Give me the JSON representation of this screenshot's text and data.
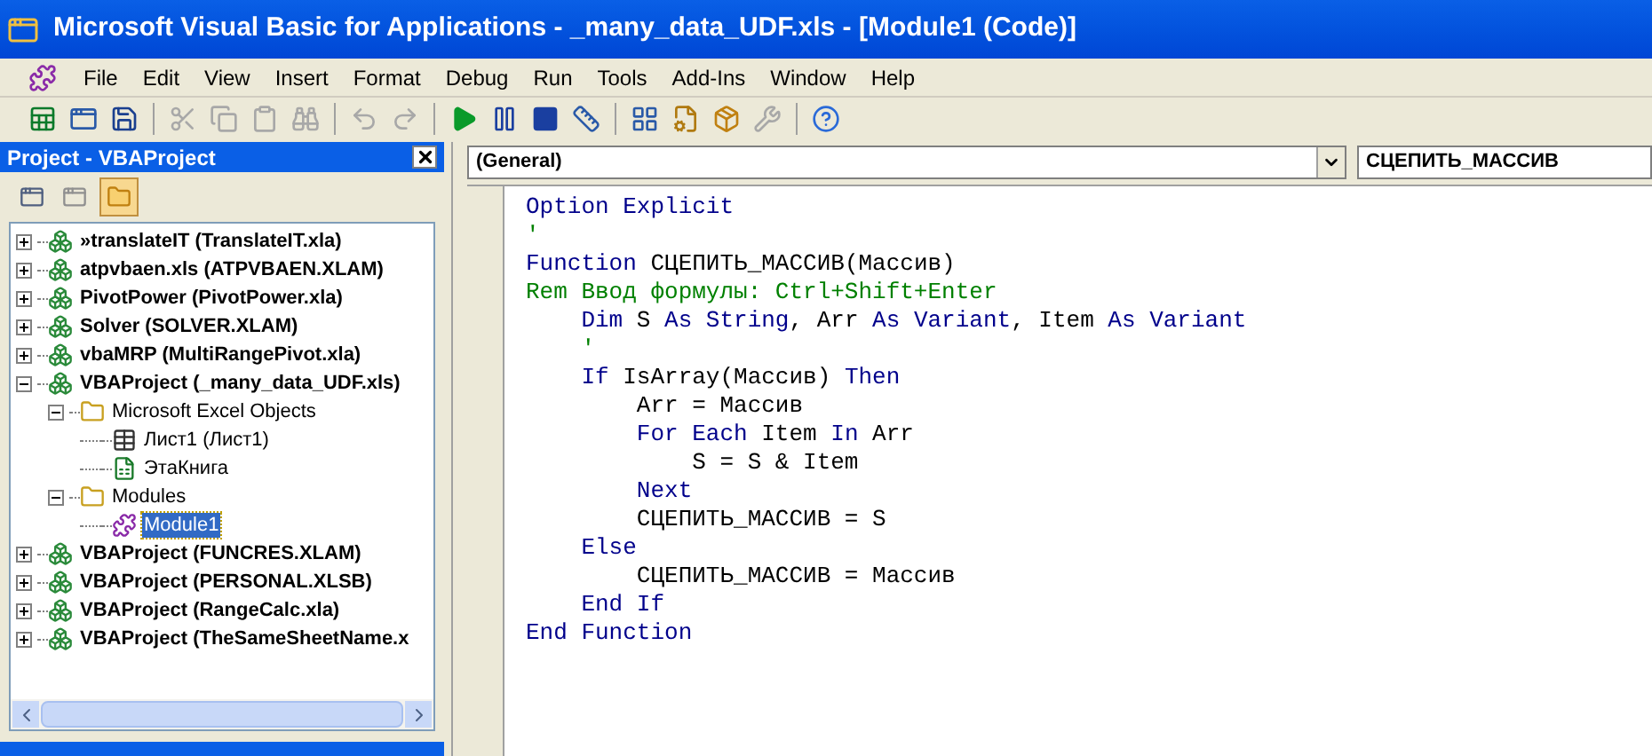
{
  "window": {
    "title": "Microsoft Visual Basic for Applications - _many_data_UDF.xls - [Module1 (Code)]"
  },
  "menu": [
    "File",
    "Edit",
    "View",
    "Insert",
    "Format",
    "Debug",
    "Run",
    "Tools",
    "Add-Ins",
    "Window",
    "Help"
  ],
  "toolbar": [
    {
      "kind": "excel",
      "disabled": false
    },
    {
      "kind": "insert",
      "disabled": false
    },
    {
      "kind": "save",
      "disabled": false
    },
    {
      "kind": "sep"
    },
    {
      "kind": "cut",
      "disabled": true
    },
    {
      "kind": "copy",
      "disabled": true
    },
    {
      "kind": "paste",
      "disabled": true
    },
    {
      "kind": "find",
      "disabled": true
    },
    {
      "kind": "sep"
    },
    {
      "kind": "undo",
      "disabled": true
    },
    {
      "kind": "redo",
      "disabled": true
    },
    {
      "kind": "sep"
    },
    {
      "kind": "run",
      "disabled": false
    },
    {
      "kind": "pause",
      "disabled": false
    },
    {
      "kind": "stop",
      "disabled": false
    },
    {
      "kind": "design",
      "disabled": false
    },
    {
      "kind": "sep"
    },
    {
      "kind": "explorer",
      "disabled": false
    },
    {
      "kind": "properties",
      "disabled": false
    },
    {
      "kind": "browser",
      "disabled": false
    },
    {
      "kind": "toolbox",
      "disabled": true
    },
    {
      "kind": "sep"
    },
    {
      "kind": "help",
      "disabled": false
    }
  ],
  "project_panel": {
    "title": "Project - VBAProject",
    "tree": [
      {
        "kind": "project",
        "label": "»translateIT (TranslateIT.xla)",
        "expanded": false,
        "selected": false
      },
      {
        "kind": "project",
        "label": "atpvbaen.xls (ATPVBAEN.XLAM)",
        "expanded": false,
        "selected": false
      },
      {
        "kind": "project",
        "label": "PivotPower (PivotPower.xla)",
        "expanded": false,
        "selected": false
      },
      {
        "kind": "project",
        "label": "Solver (SOLVER.XLAM)",
        "expanded": false,
        "selected": false
      },
      {
        "kind": "project",
        "label": "vbaMRP (MultiRangePivot.xla)",
        "expanded": false,
        "selected": false
      },
      {
        "kind": "project",
        "label": "VBAProject (_many_data_UDF.xls)",
        "expanded": true,
        "selected": false,
        "children": [
          {
            "kind": "folder",
            "label": "Microsoft Excel Objects",
            "expanded": true,
            "selected": false,
            "children": [
              {
                "kind": "sheet",
                "label": "Лист1 (Лист1)",
                "selected": false
              },
              {
                "kind": "workbook",
                "label": "ЭтаКнига",
                "selected": false
              }
            ]
          },
          {
            "kind": "folder",
            "label": "Modules",
            "expanded": true,
            "selected": false,
            "children": [
              {
                "kind": "module",
                "label": "Module1",
                "selected": true
              }
            ]
          }
        ]
      },
      {
        "kind": "project",
        "label": "VBAProject (FUNCRES.XLAM)",
        "expanded": false,
        "selected": false
      },
      {
        "kind": "project",
        "label": "VBAProject (PERSONAL.XLSB)",
        "expanded": false,
        "selected": false
      },
      {
        "kind": "project",
        "label": "VBAProject (RangeCalc.xla)",
        "expanded": false,
        "selected": false
      },
      {
        "kind": "project",
        "label": "VBAProject (TheSameSheetName.x",
        "expanded": false,
        "selected": false
      }
    ]
  },
  "code_window": {
    "object_box": "(General)",
    "procedure_box": "СЦЕПИТЬ_МАССИВ",
    "lines": [
      [
        {
          "kind": "keyword",
          "text": "Option Explicit"
        }
      ],
      [
        {
          "kind": "comment",
          "text": "'"
        }
      ],
      [
        {
          "kind": "keyword",
          "text": "Function"
        },
        {
          "kind": "plain",
          "text": " СЦЕПИТЬ_МАССИВ(Массив)"
        }
      ],
      [
        {
          "kind": "comment",
          "text": "Rem Ввод формулы: Ctrl+Shift+Enter"
        }
      ],
      [
        {
          "kind": "keyword",
          "text": "    Dim"
        },
        {
          "kind": "plain",
          "text": " S "
        },
        {
          "kind": "keyword",
          "text": "As String"
        },
        {
          "kind": "plain",
          "text": ", Arr "
        },
        {
          "kind": "keyword",
          "text": "As Variant"
        },
        {
          "kind": "plain",
          "text": ", Item "
        },
        {
          "kind": "keyword",
          "text": "As Variant"
        }
      ],
      [
        {
          "kind": "comment",
          "text": "    '"
        }
      ],
      [
        {
          "kind": "keyword",
          "text": "    If"
        },
        {
          "kind": "plain",
          "text": " IsArray(Массив) "
        },
        {
          "kind": "keyword",
          "text": "Then"
        }
      ],
      [
        {
          "kind": "plain",
          "text": "        Arr = Массив"
        }
      ],
      [
        {
          "kind": "keyword",
          "text": "        For Each"
        },
        {
          "kind": "plain",
          "text": " Item "
        },
        {
          "kind": "keyword",
          "text": "In"
        },
        {
          "kind": "plain",
          "text": " Arr"
        }
      ],
      [
        {
          "kind": "plain",
          "text": "            S = S & Item"
        }
      ],
      [
        {
          "kind": "keyword",
          "text": "        Next"
        }
      ],
      [
        {
          "kind": "plain",
          "text": "        СЦЕПИТЬ_МАССИВ = S"
        }
      ],
      [
        {
          "kind": "keyword",
          "text": "    Else"
        }
      ],
      [
        {
          "kind": "plain",
          "text": "        СЦЕПИТЬ_МАССИВ = Массив"
        }
      ],
      [
        {
          "kind": "keyword",
          "text": "    End If"
        }
      ],
      [
        {
          "kind": "keyword",
          "text": "End Function"
        }
      ]
    ]
  }
}
